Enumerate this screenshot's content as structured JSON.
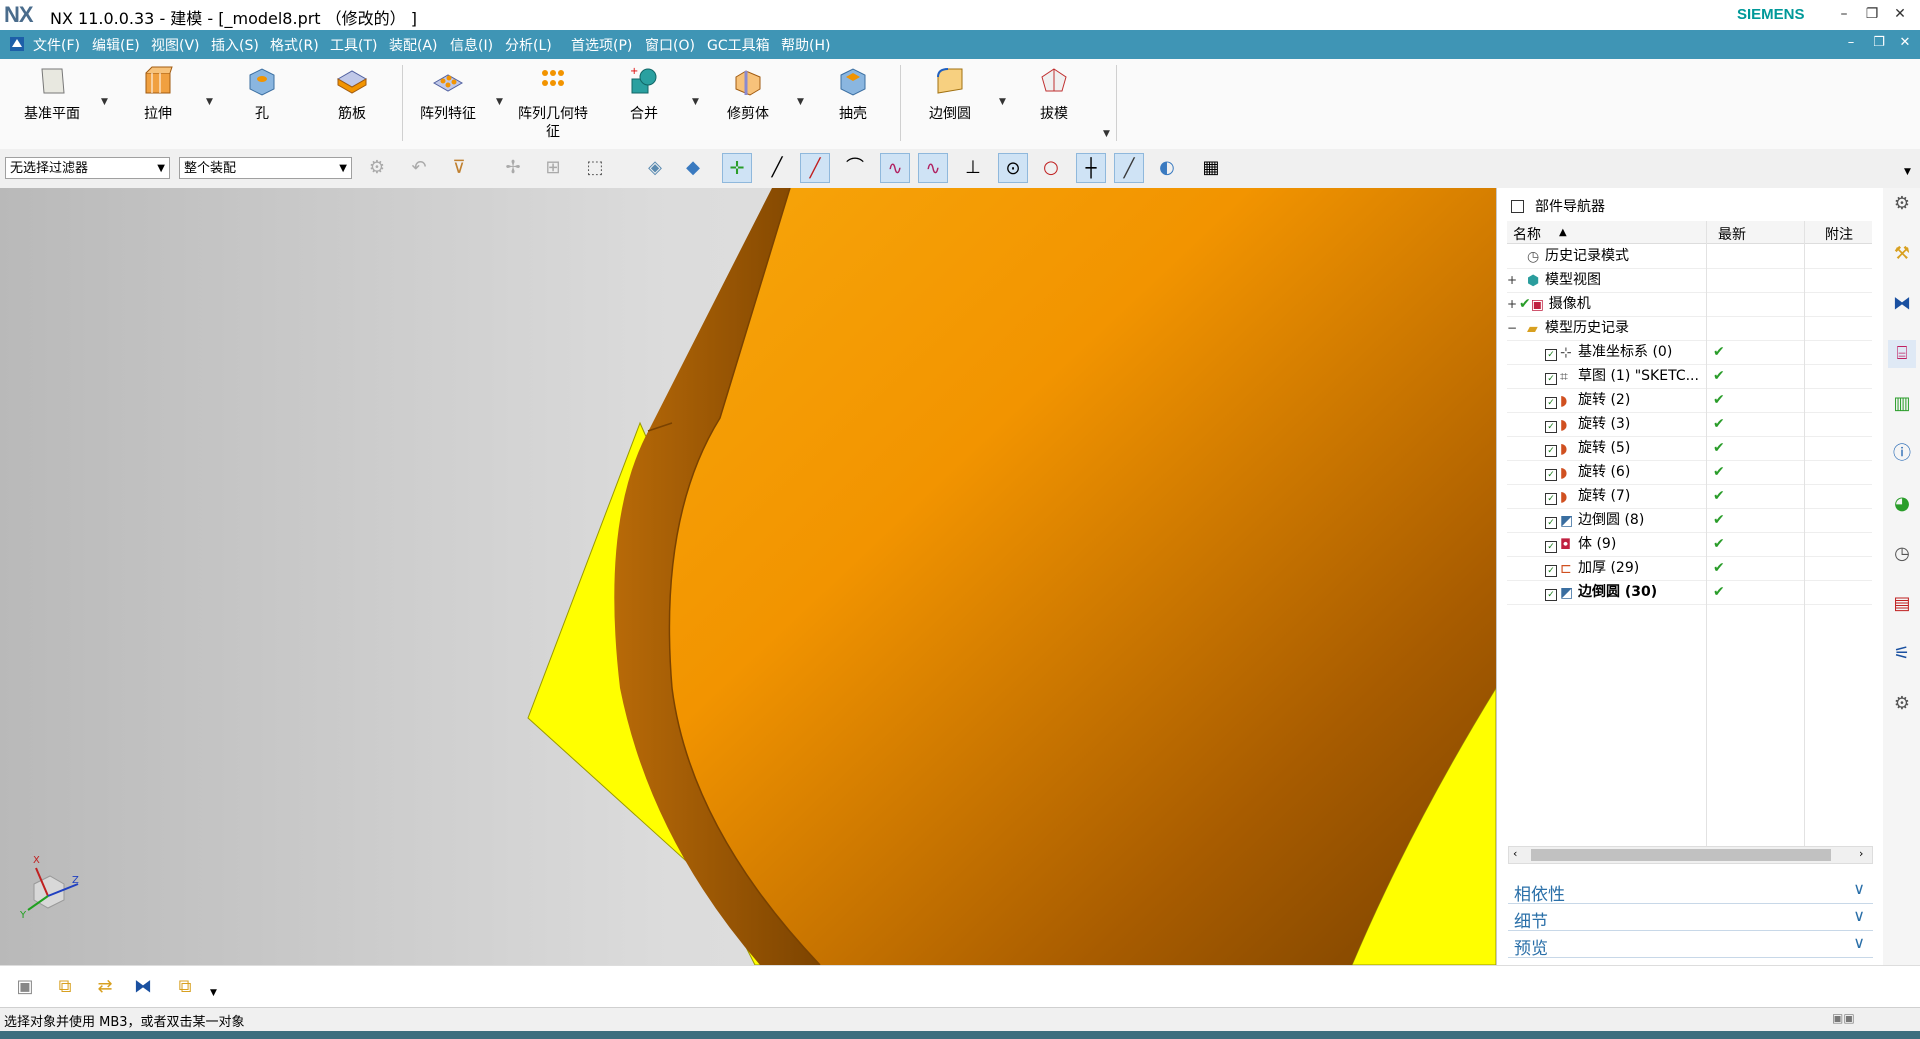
{
  "window": {
    "logo": "NX",
    "title": "NX 11.0.0.33 - 建模 - [_model8.prt （修改的） ]",
    "brand": "SIEMENS",
    "controls": [
      "–",
      "❐",
      "✕"
    ]
  },
  "menubar": {
    "items": [
      "文件(F)",
      "编辑(E)",
      "视图(V)",
      "插入(S)",
      "格式(R)",
      "工具(T)",
      "装配(A)",
      "信息(I)",
      "分析(L)",
      "首选项(P)",
      "窗口(O)",
      "GC工具箱",
      "帮助(H)"
    ],
    "controls": [
      "–",
      "❐",
      "✕"
    ]
  },
  "ribbon": {
    "buttons": [
      {
        "label": "基准平面",
        "icon": "datum-plane-icon"
      },
      {
        "label": "拉伸",
        "icon": "extrude-icon"
      },
      {
        "label": "孔",
        "icon": "hole-icon"
      },
      {
        "label": "筋板",
        "icon": "rib-icon"
      },
      {
        "label": "阵列特征",
        "icon": "pattern-feature-icon"
      },
      {
        "label": "阵列几何特征",
        "icon": "pattern-geometry-icon"
      },
      {
        "label": "合并",
        "icon": "unite-icon"
      },
      {
        "label": "修剪体",
        "icon": "trim-body-icon"
      },
      {
        "label": "抽壳",
        "icon": "shell-icon"
      },
      {
        "label": "边倒圆",
        "icon": "edge-blend-icon"
      },
      {
        "label": "拔模",
        "icon": "draft-icon"
      }
    ]
  },
  "selection_bar": {
    "filter": "无选择过滤器",
    "scope": "整个装配"
  },
  "navigator": {
    "title": "部件导航器",
    "columns": [
      "名称",
      "最新",
      "附注"
    ],
    "items": [
      {
        "name": "历史记录模式",
        "latest": ""
      },
      {
        "name": "模型视图",
        "latest": ""
      },
      {
        "name": "摄像机",
        "latest": ""
      },
      {
        "name": "模型历史记录",
        "latest": ""
      },
      {
        "name": "基准坐标系 (0)",
        "latest": "✔"
      },
      {
        "name": "草图 (1) \"SKETC...",
        "latest": "✔"
      },
      {
        "name": "旋转 (2)",
        "latest": "✔"
      },
      {
        "name": "旋转 (3)",
        "latest": "✔"
      },
      {
        "name": "旋转 (5)",
        "latest": "✔"
      },
      {
        "name": "旋转 (6)",
        "latest": "✔"
      },
      {
        "name": "旋转 (7)",
        "latest": "✔"
      },
      {
        "name": "边倒圆 (8)",
        "latest": "✔"
      },
      {
        "name": "体 (9)",
        "latest": "✔"
      },
      {
        "name": "加厚 (29)",
        "latest": "✔"
      },
      {
        "name": "边倒圆 (30)",
        "latest": "✔"
      }
    ],
    "sections": [
      "相依性",
      "细节",
      "预览"
    ]
  },
  "triad": {
    "x": "X",
    "y": "Y",
    "z": "Z"
  },
  "status": {
    "text": "选择对象并使用 MB3，或者双击某一对象"
  },
  "colors": {
    "menubar": "#3f95b5",
    "body": "#f29400",
    "sheet": "#ffff00",
    "check": "#2a9d2a"
  }
}
